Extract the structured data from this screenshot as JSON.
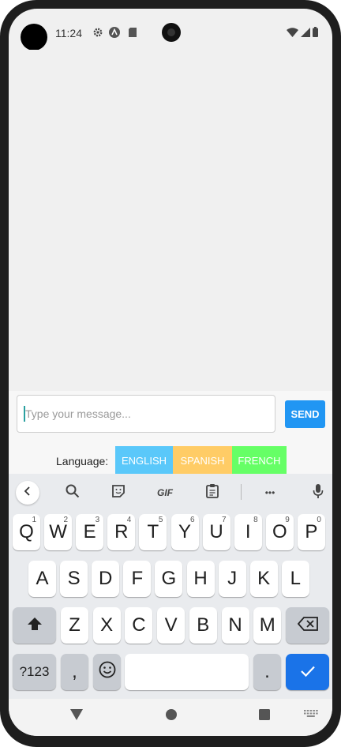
{
  "status_bar": {
    "time": "11:24",
    "icons": [
      "gear-icon",
      "notification-a-icon",
      "sd-card-icon",
      "wifi-icon",
      "signal-icon",
      "battery-icon"
    ]
  },
  "composer": {
    "placeholder": "Type your message...",
    "send_label": "SEND"
  },
  "language": {
    "label": "Language:",
    "options": [
      {
        "label": "ENGLISH",
        "color": "#5ac8fa"
      },
      {
        "label": "SPANISH",
        "color": "#ffcc66"
      },
      {
        "label": "FRENCH",
        "color": "#66ff66"
      }
    ]
  },
  "keyboard": {
    "toolbar_icons": [
      "chevron-left-icon",
      "search-icon",
      "sticker-icon",
      "gif-icon",
      "clipboard-icon",
      "more-icon",
      "mic-icon"
    ],
    "gif_label": "GIF",
    "more_label": "•••",
    "row1": [
      {
        "key": "Q",
        "hint": "1"
      },
      {
        "key": "W",
        "hint": "2"
      },
      {
        "key": "E",
        "hint": "3"
      },
      {
        "key": "R",
        "hint": "4"
      },
      {
        "key": "T",
        "hint": "5"
      },
      {
        "key": "Y",
        "hint": "6"
      },
      {
        "key": "U",
        "hint": "7"
      },
      {
        "key": "I",
        "hint": "8"
      },
      {
        "key": "O",
        "hint": "9"
      },
      {
        "key": "P",
        "hint": "0"
      }
    ],
    "row2": [
      "A",
      "S",
      "D",
      "F",
      "G",
      "H",
      "J",
      "K",
      "L"
    ],
    "row3": [
      "Z",
      "X",
      "C",
      "V",
      "B",
      "N",
      "M"
    ],
    "symbols_label": "?123",
    "comma_label": ",",
    "period_label": ".",
    "accent_color": "#1a73e8"
  },
  "nav_bar": {
    "icons": [
      "back-triangle-icon",
      "home-circle-icon",
      "recents-square-icon",
      "keyboard-switch-icon"
    ]
  }
}
